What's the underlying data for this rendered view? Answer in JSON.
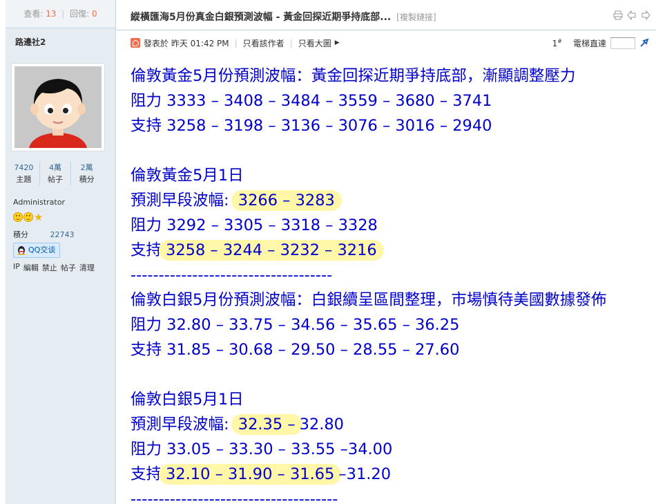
{
  "sidebar": {
    "views_label": "查看:",
    "views_count": "13",
    "replies_label": "回復:",
    "replies_count": "0",
    "author": "路邊社2",
    "counts": [
      {
        "value": "7420",
        "label": "主題"
      },
      {
        "value": "4萬",
        "label": "帖子"
      },
      {
        "value": "2萬",
        "label": "積分"
      }
    ],
    "role": "Administrator",
    "credits_label": "積分",
    "credits_value": "22743",
    "qq_label": "QQ交谈",
    "admin_links": [
      "IP",
      "編輯",
      "禁止",
      "帖子",
      "清理"
    ]
  },
  "header": {
    "title": "縱橫匯海5月份真金白銀預測波幅 - 黃金回探近期爭持底部...",
    "copy_link": "[複製鏈接]"
  },
  "postinfo": {
    "posted": "發表於 昨天 01:42 PM",
    "only_author": "只看該作者",
    "only_large": "只看大圖",
    "floor": "1",
    "floor_mark": "#",
    "jump_label": "電梯直達"
  },
  "post": {
    "gold_title": "倫敦黃金5月份預測波幅：黃金回探近期爭持底部，漸顯調整壓力",
    "gold_res": "阻力 3333 – 3408 – 3484 – 3559 – 3680 – 3741",
    "gold_sup": "支持 3258 – 3198 – 3136 – 3076 – 3016 – 2940",
    "gold_day": "倫敦黃金5月1日",
    "gold_range_label": "預測早段波幅:",
    "gold_range_value": "3266 – 3283",
    "gold_day_res": "阻力 3292 – 3305 – 3318 – 3328",
    "gold_day_sup_label": "支持",
    "gold_day_sup_value": "3258 – 3244 – 3232 – 3216",
    "divider1": "------------------------------------",
    "silver_title": "倫敦白銀5月份預測波幅：白銀續呈區間整理，市場慎待美國數據發佈",
    "silver_res": "阻力 32.80 – 33.75 – 34.56 – 35.65 – 36.25",
    "silver_sup": "支持 31.85 – 30.68 – 29.50 – 28.55 – 27.60",
    "silver_day": "倫敦白銀5月1日",
    "silver_range_label": "預測早段波幅:",
    "silver_range_hl": "32.35 –",
    "silver_range_rest": "32.80",
    "silver_day_res": "阻力 33.05 – 33.30 – 33.55 –34.00",
    "silver_day_sup_label": "支持",
    "silver_day_sup_hl": "32.10 – 31.90 – 31.65",
    "silver_day_sup_rest": "–31.20",
    "divider2": "-------------------------------------"
  },
  "colors": {
    "content_text": "#0000cc",
    "highlight": "#fff6a8",
    "sidebar_bg": "#e5edf2",
    "accent_count": "#f26c4f"
  }
}
